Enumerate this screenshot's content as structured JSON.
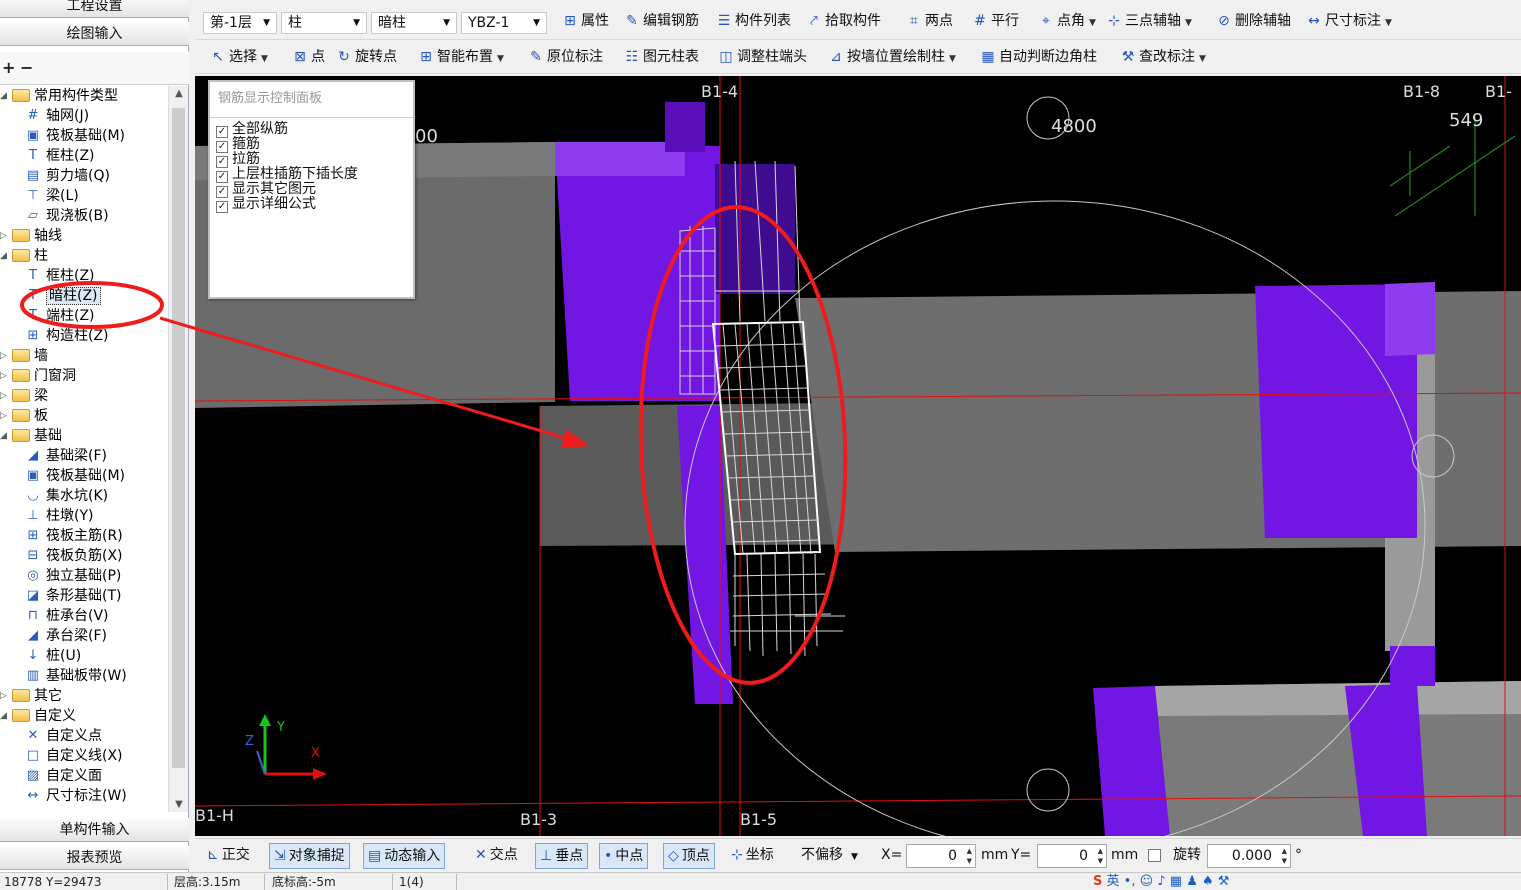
{
  "left_panel": {
    "top_buttons": [
      "工程设置",
      "绘图输入"
    ],
    "controls": {
      "expand": "+",
      "collapse": "−"
    },
    "tree": [
      {
        "label": "常用构件类型",
        "level": 0,
        "folder": true,
        "expanded": true
      },
      {
        "label": "轴网(J)",
        "level": 1,
        "icon": "grid-icon"
      },
      {
        "label": "筏板基础(M)",
        "level": 1,
        "icon": "raft-foundation-icon"
      },
      {
        "label": "框柱(Z)",
        "level": 1,
        "icon": "column-icon"
      },
      {
        "label": "剪力墙(Q)",
        "level": 1,
        "icon": "shear-wall-icon"
      },
      {
        "label": "梁(L)",
        "level": 1,
        "icon": "beam-icon"
      },
      {
        "label": "现浇板(B)",
        "level": 1,
        "icon": "slab-icon"
      },
      {
        "label": "轴线",
        "level": 0,
        "folder": true,
        "expanded": false
      },
      {
        "label": "柱",
        "level": 0,
        "folder": true,
        "expanded": true
      },
      {
        "label": "框柱(Z)",
        "level": 1,
        "icon": "column-icon"
      },
      {
        "label": "暗柱(Z)",
        "level": 1,
        "icon": "column-icon",
        "selected": true
      },
      {
        "label": "端柱(Z)",
        "level": 1,
        "icon": "column-icon"
      },
      {
        "label": "构造柱(Z)",
        "level": 1,
        "icon": "constructional-column-icon"
      },
      {
        "label": "墙",
        "level": 0,
        "folder": true,
        "expanded": false
      },
      {
        "label": "门窗洞",
        "level": 0,
        "folder": true,
        "expanded": false
      },
      {
        "label": "梁",
        "level": 0,
        "folder": true,
        "expanded": false
      },
      {
        "label": "板",
        "level": 0,
        "folder": true,
        "expanded": false
      },
      {
        "label": "基础",
        "level": 0,
        "folder": true,
        "expanded": true
      },
      {
        "label": "基础梁(F)",
        "level": 1,
        "icon": "foundation-beam-icon"
      },
      {
        "label": "筏板基础(M)",
        "level": 1,
        "icon": "raft-foundation-icon"
      },
      {
        "label": "集水坑(K)",
        "level": 1,
        "icon": "sump-icon"
      },
      {
        "label": "柱墩(Y)",
        "level": 1,
        "icon": "column-pier-icon"
      },
      {
        "label": "筏板主筋(R)",
        "level": 1,
        "icon": "raft-main-rebar-icon"
      },
      {
        "label": "筏板负筋(X)",
        "level": 1,
        "icon": "raft-negative-rebar-icon"
      },
      {
        "label": "独立基础(P)",
        "level": 1,
        "icon": "isolated-footing-icon"
      },
      {
        "label": "条形基础(T)",
        "level": 1,
        "icon": "strip-footing-icon"
      },
      {
        "label": "桩承台(V)",
        "level": 1,
        "icon": "pile-cap-icon"
      },
      {
        "label": "承台梁(F)",
        "level": 1,
        "icon": "cap-beam-icon"
      },
      {
        "label": "桩(U)",
        "level": 1,
        "icon": "pile-icon"
      },
      {
        "label": "基础板带(W)",
        "level": 1,
        "icon": "foundation-strip-icon"
      },
      {
        "label": "其它",
        "level": 0,
        "folder": true,
        "expanded": false
      },
      {
        "label": "自定义",
        "level": 0,
        "folder": true,
        "expanded": true
      },
      {
        "label": "自定义点",
        "level": 1,
        "icon": "custom-point-icon"
      },
      {
        "label": "自定义线(X)",
        "level": 1,
        "icon": "custom-line-icon"
      },
      {
        "label": "自定义面",
        "level": 1,
        "icon": "custom-face-icon"
      },
      {
        "label": "尺寸标注(W)",
        "level": 1,
        "icon": "dimension-icon"
      }
    ],
    "bottom_buttons": [
      "单构件输入",
      "报表预览"
    ]
  },
  "toolbar1": {
    "floor": "第-1层",
    "category": "柱",
    "type": "暗柱",
    "component": "YBZ-1",
    "items": [
      {
        "label": "属性",
        "icon": "properties-icon"
      },
      {
        "label": "编辑钢筋",
        "icon": "edit-rebar-icon"
      },
      {
        "label": "构件列表",
        "icon": "component-list-icon"
      },
      {
        "label": "拾取构件",
        "icon": "pick-component-icon"
      },
      {
        "label": "两点",
        "icon": "two-point-icon"
      },
      {
        "label": "平行",
        "icon": "parallel-icon"
      },
      {
        "label": "点角",
        "icon": "point-angle-icon",
        "dropdown": true
      },
      {
        "label": "三点辅轴",
        "icon": "three-point-axis-icon",
        "dropdown": true
      },
      {
        "label": "删除辅轴",
        "icon": "delete-axis-icon"
      },
      {
        "label": "尺寸标注",
        "icon": "dimension-icon",
        "dropdown": true
      }
    ]
  },
  "toolbar2": {
    "items": [
      {
        "label": "选择",
        "icon": "select-cursor-icon",
        "dropdown": true
      },
      {
        "label": "点",
        "icon": "point-icon"
      },
      {
        "label": "旋转点",
        "icon": "rotate-point-icon"
      },
      {
        "label": "智能布置",
        "icon": "smart-layout-icon",
        "dropdown": true
      },
      {
        "label": "原位标注",
        "icon": "in-place-label-icon"
      },
      {
        "label": "图元柱表",
        "icon": "column-table-icon"
      },
      {
        "label": "调整柱端头",
        "icon": "adjust-column-end-icon"
      },
      {
        "label": "按墙位置绘制柱",
        "icon": "draw-by-wall-icon",
        "dropdown": true
      },
      {
        "label": "自动判断边角柱",
        "icon": "auto-corner-column-icon"
      },
      {
        "label": "查改标注",
        "icon": "check-label-icon",
        "dropdown": true
      }
    ]
  },
  "rebar_panel": {
    "title": "钢筋显示控制面板",
    "options": [
      {
        "label": "全部纵筋",
        "checked": true
      },
      {
        "label": "箍筋",
        "checked": true
      },
      {
        "label": "拉筋",
        "checked": true
      },
      {
        "label": "上层柱插筋下插长度",
        "checked": true
      },
      {
        "label": "显示其它图元",
        "checked": true
      },
      {
        "label": "显示详细公式",
        "checked": true
      }
    ]
  },
  "viewport": {
    "axis_labels": {
      "top_b1_4": "B1-4",
      "top_b1_8": "B1-8",
      "top_b1_right": "B1-",
      "bottom_b1_h": "B1-H",
      "bottom_b1_3": "B1-3",
      "bottom_b1_5": "B1-5"
    },
    "dimensions": {
      "dim_4800": "4800",
      "dim_549": "549",
      "dim_00": "00"
    },
    "ucs": {
      "x": "X",
      "y": "Y",
      "z": "Z"
    },
    "colors": {
      "background": "#000000",
      "wall_gray": "#6e6e6e",
      "column_purple": "#7216e4",
      "axis_red": "#e01010",
      "rebar": "#d8d8d8",
      "highlight": "#ee1c1c",
      "grid_green": "#2a9a2a"
    }
  },
  "snapbar": {
    "items": [
      {
        "label": "正交",
        "icon": "ortho-icon",
        "on": false
      },
      {
        "label": "对象捕捉",
        "icon": "object-snap-icon",
        "on": true
      },
      {
        "label": "动态输入",
        "icon": "dynamic-input-icon",
        "on": true
      },
      {
        "label": "交点",
        "icon": "intersection-icon",
        "on": false
      },
      {
        "label": "垂点",
        "icon": "perpendicular-icon",
        "on": true
      },
      {
        "label": "中点",
        "icon": "midpoint-icon",
        "on": true
      },
      {
        "label": "顶点",
        "icon": "vertex-icon",
        "on": true
      },
      {
        "label": "坐标",
        "icon": "coordinate-icon",
        "on": false
      }
    ],
    "offset_mode": "不偏移",
    "x_label": "X=",
    "x_value": "0",
    "x_unit": "mm",
    "y_label": "Y=",
    "y_value": "0",
    "y_unit": "mm",
    "rotate_label": "旋转",
    "rotate_value": "0.000",
    "degree": "°"
  },
  "statusbar": {
    "coords": "18778 Y=29473",
    "floor_height": "层高:3.15m",
    "base_height": "底标高:-5m",
    "count": "1(4)",
    "ime": "英"
  }
}
